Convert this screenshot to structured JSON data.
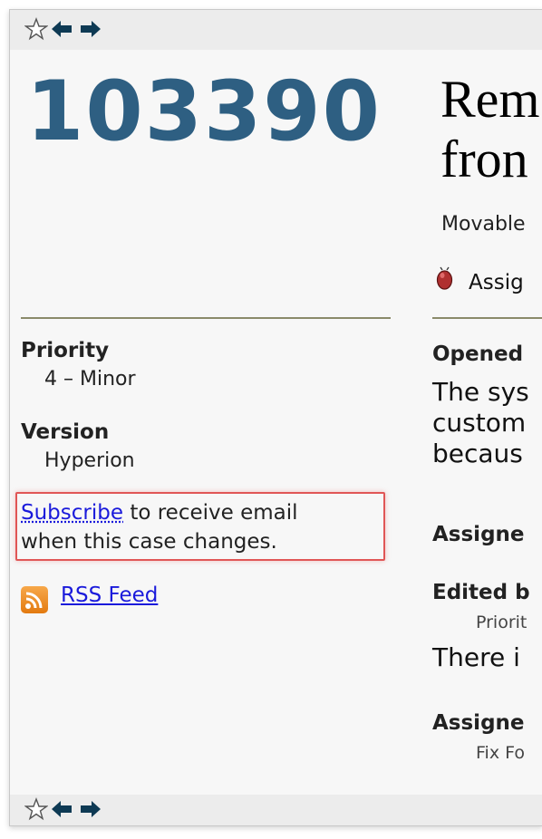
{
  "toolbar": {
    "star_icon": "star-outline-icon",
    "back_icon": "left-arrow-icon",
    "forward_icon": "right-arrow-icon"
  },
  "case": {
    "number": "103390",
    "title_line1": "Rem",
    "title_line2": "fron",
    "project": "Movable",
    "status": "Assig"
  },
  "sidebar": {
    "priority_label": "Priority",
    "priority_value": "4 – Minor",
    "version_label": "Version",
    "version_value": "Hyperion",
    "subscribe_link": "Subscribe",
    "subscribe_text1": " to receive email",
    "subscribe_text2": "when this case changes.",
    "rss_link": "RSS Feed"
  },
  "events": {
    "opened_label": "Opened",
    "opened_line1": "The sys",
    "opened_line2": "custom",
    "opened_line3": "becaus",
    "assigned1": "Assigne",
    "edited_label": "Edited b",
    "edited_detail": "Priorit",
    "edited_text": "There i",
    "assigned2": "Assigne",
    "assigned2_detail": "Fix Fo"
  },
  "colors": {
    "case_number": "#2e5f82",
    "link": "#1a1adb",
    "highlight_box": "#e05656"
  }
}
